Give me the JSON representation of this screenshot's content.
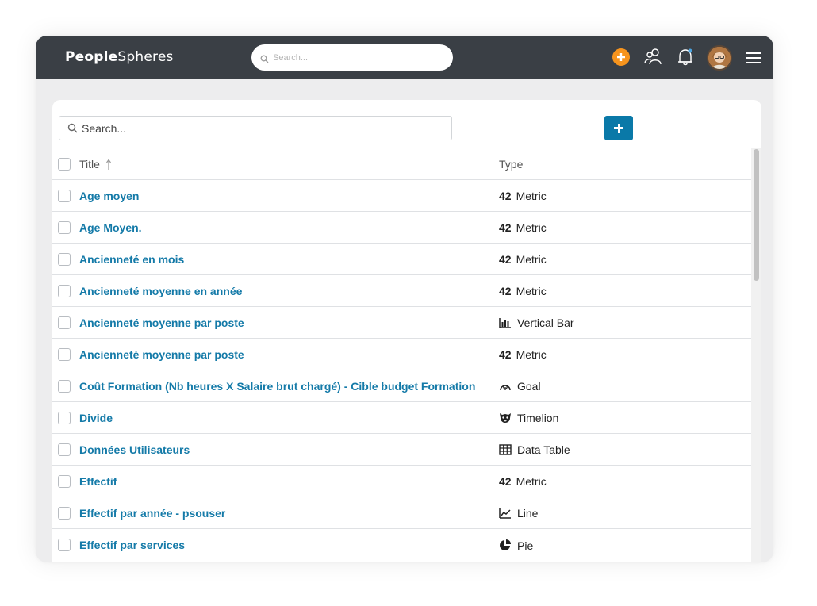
{
  "app": {
    "logo_bold": "People",
    "logo_light": "Spheres",
    "search_placeholder": "Search..."
  },
  "list": {
    "search_placeholder": "Search...",
    "columns": {
      "title": "Title",
      "type": "Type"
    },
    "rows": [
      {
        "title": "Age moyen",
        "type": "Metric",
        "icon": "metric-icon",
        "icon_text": "42"
      },
      {
        "title": "Age Moyen.",
        "type": "Metric",
        "icon": "metric-icon",
        "icon_text": "42"
      },
      {
        "title": "Ancienneté en mois",
        "type": "Metric",
        "icon": "metric-icon",
        "icon_text": "42"
      },
      {
        "title": "Ancienneté moyenne en année",
        "type": "Metric",
        "icon": "metric-icon",
        "icon_text": "42"
      },
      {
        "title": "Ancienneté moyenne par poste",
        "type": "Vertical Bar",
        "icon": "vertical-bar-icon",
        "icon_text": ""
      },
      {
        "title": "Ancienneté moyenne par poste",
        "type": "Metric",
        "icon": "metric-icon",
        "icon_text": "42"
      },
      {
        "title": "Coût Formation (Nb heures X Salaire brut chargé) - Cible budget Formation",
        "type": "Goal",
        "icon": "goal-icon",
        "icon_text": ""
      },
      {
        "title": "Divide",
        "type": "Timelion",
        "icon": "timelion-icon",
        "icon_text": ""
      },
      {
        "title": "Données Utilisateurs",
        "type": "Data Table",
        "icon": "data-table-icon",
        "icon_text": ""
      },
      {
        "title": "Effectif",
        "type": "Metric",
        "icon": "metric-icon",
        "icon_text": "42"
      },
      {
        "title": "Effectif par année - psouser",
        "type": "Line",
        "icon": "line-chart-icon",
        "icon_text": ""
      },
      {
        "title": "Effectif par services",
        "type": "Pie",
        "icon": "pie-chart-icon",
        "icon_text": ""
      }
    ]
  },
  "colors": {
    "topbar": "#3a3f45",
    "accent_orange": "#f7941d",
    "link_blue": "#147aa8",
    "button_blue": "#0a79a8"
  }
}
